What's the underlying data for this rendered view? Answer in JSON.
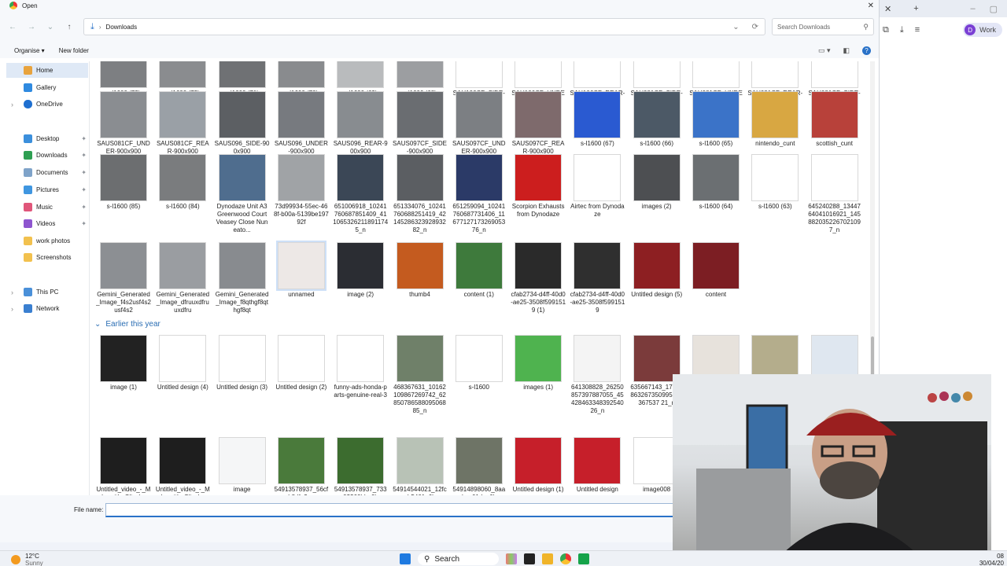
{
  "dialog": {
    "title": "Open",
    "address": {
      "folder": "Downloads"
    },
    "search_placeholder": "Search Downloads",
    "toolbar": {
      "organise": "Organise ▾",
      "new_folder": "New folder"
    },
    "file_name_label": "File name:",
    "file_name_value": ""
  },
  "sidebar": {
    "items": [
      {
        "label": "Home",
        "name": "home"
      },
      {
        "label": "Gallery",
        "name": "gallery"
      },
      {
        "label": "OneDrive",
        "name": "onedrive"
      },
      {
        "label": "Desktop",
        "name": "desktop"
      },
      {
        "label": "Downloads",
        "name": "downloads"
      },
      {
        "label": "Documents",
        "name": "documents"
      },
      {
        "label": "Pictures",
        "name": "pictures"
      },
      {
        "label": "Music",
        "name": "music"
      },
      {
        "label": "Videos",
        "name": "videos"
      },
      {
        "label": "work photos",
        "name": "work-photos"
      },
      {
        "label": "Screenshots",
        "name": "screenshots"
      },
      {
        "label": "This PC",
        "name": "this-pc"
      },
      {
        "label": "Network",
        "name": "network"
      }
    ]
  },
  "files": {
    "row0": [
      "s-l1600 (73)",
      "s-l1600 (72)",
      "s-l1600 (71)",
      "s-l1600 (70)",
      "s-l1600 (69)",
      "s-l1600 (68)",
      "SAU106CF_SIDE-900x900",
      "SAU106CF_UNDER-900x900",
      "SAU106CF_REAR-900x900",
      "SAU081CF_SIDE-900x900",
      "SAU081CF_UNDER-900x900",
      "SAU081CF_REAR-900x900",
      "SAU081CF_SIDE-900x900"
    ],
    "row1": [
      "SAUS081CF_UNDER-900x900",
      "SAUS081CF_REAR-900x900",
      "SAUS096_SIDE-900x900",
      "SAUS096_UNDER-900x900",
      "SAUS096_REAR-900x900",
      "SAUS097CF_SIDE-900x900",
      "SAUS097CF_UNDER-900x900",
      "SAUS097CF_REAR-900x900",
      "s-l1600 (67)",
      "s-l1600 (66)",
      "s-l1600 (65)",
      "nintendo_cunt",
      "scottish_cunt"
    ],
    "row2": [
      "s-l1600 (85)",
      "s-l1600 (84)",
      "Dynodaze Unit A3 Greenwood Court Veasey Close Nuneato...",
      "73d99934-55ec-468f-b00a-5139be19792f",
      "651006918_10241760687851409_4110653262118911745_n",
      "651334076_10241760688251419_42145286323928932 82_n",
      "651259094_10241760687731406_11677127173269053 76_n",
      "Scorpion Exhausts from Dynodaze",
      "Airtec from Dynodaze",
      "images (2)",
      "s-l1600 (64)",
      "s-l1600 (63)",
      "645240288_1344764041016921_1458820352267021097_n"
    ],
    "row3": [
      "Gemini_Generated_Image_f4s2usf4s2usf4s2",
      "Gemini_Generated_Image_dfruuxdfruuxdfru",
      "Gemini_Generated_Image_f8qthgf8qthgf8qt",
      "unnamed",
      "image (2)",
      "thumb4",
      "content (1)",
      "cfab2734-d4ff-40d0-ae25-3508f5991519 (1)",
      "cfab2734-d4ff-40d0-ae25-3508f5991519",
      "Untitled design (5)",
      "content"
    ],
    "group_header": "Earlier this year",
    "row4": [
      "image (1)",
      "Untitled design (4)",
      "Untitled design (3)",
      "Untitled design (2)",
      "funny-ads-honda-parts-genuine-real-3",
      "468367631_10162109867269742_62850786588095068 85_n",
      "s-l1600",
      "images (1)",
      "641308828_26250857397887055_4542846334839254026_n",
      "635667143_17264863267350995636367537 21_n",
      "",
      "",
      ""
    ],
    "row5": [
      "Untitled_video_-_Made_with_Clipchamp_17 (1)",
      "Untitled_video_-_Made_with_Clipchamp_17",
      "image",
      "54913578937_56cfb8dfa2_o",
      "54913578937_73303260bb_6k",
      "54914544021_12fccb5461_6k",
      "54914898060_8aabec61de_6k",
      "Untitled design (1)",
      "Untitled design",
      "image008"
    ]
  },
  "chrome": {
    "profile_label": "Work",
    "profile_initial": "D"
  },
  "taskbar": {
    "temp": "12°C",
    "cond": "Sunny",
    "search": "Search",
    "time": "08",
    "date": "30/04/20"
  }
}
